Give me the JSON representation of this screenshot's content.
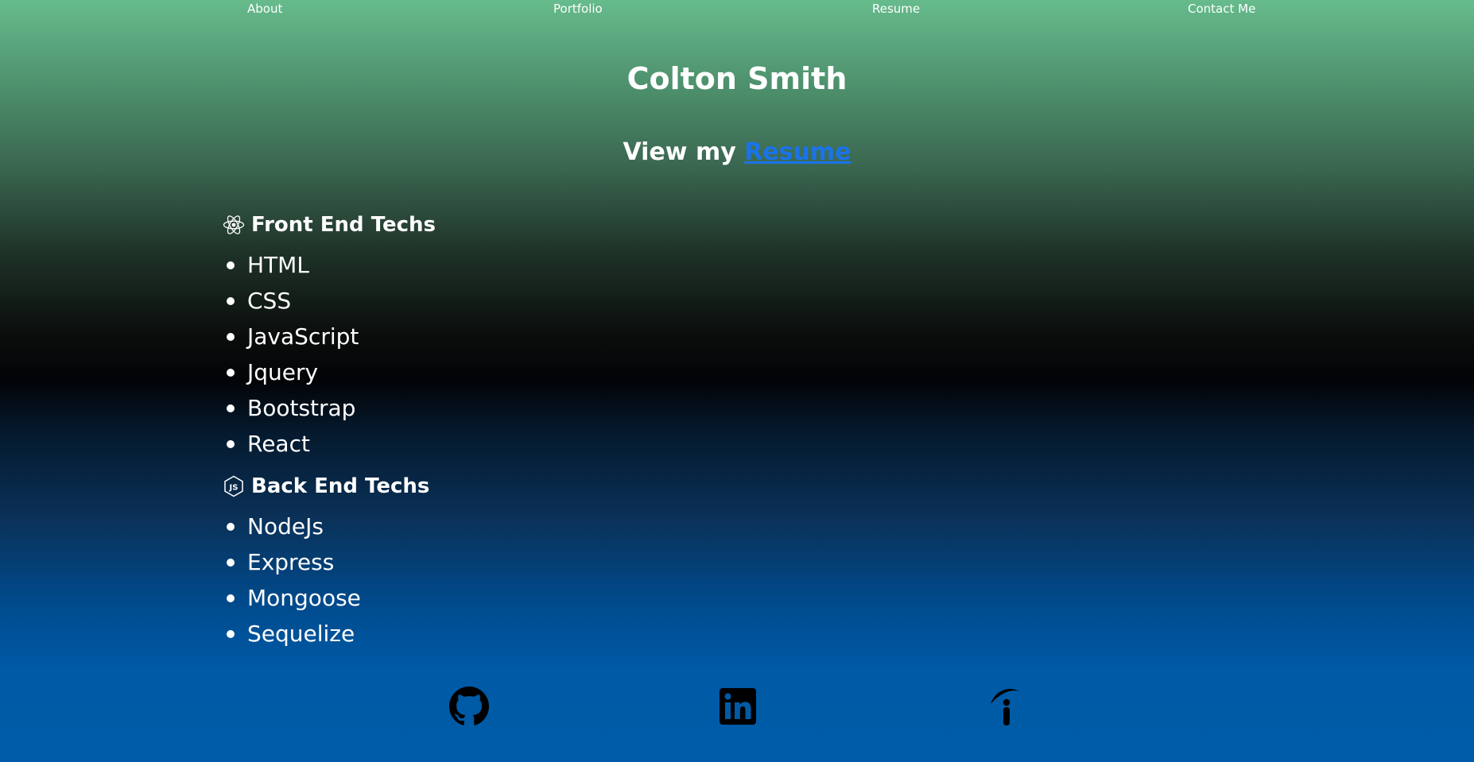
{
  "nav": {
    "items": [
      {
        "label": "About"
      },
      {
        "label": "Portfolio"
      },
      {
        "label": "Resume"
      },
      {
        "label": "Contact Me"
      }
    ]
  },
  "header": {
    "name": "Colton Smith",
    "resume_prefix": "View my",
    "resume_link": "Resume"
  },
  "front_end": {
    "title": "Front End Techs",
    "icon": "react-icon",
    "items": [
      "HTML",
      "CSS",
      "JavaScript",
      "Jquery",
      "Bootstrap",
      "React"
    ]
  },
  "back_end": {
    "title": "Back End Techs",
    "icon": "nodejs-icon",
    "items": [
      "NodeJs",
      "Express",
      "Mongoose",
      "Sequelize"
    ]
  },
  "social": [
    {
      "icon": "github-icon"
    },
    {
      "icon": "linkedin-icon"
    },
    {
      "icon": "indeed-icon"
    }
  ],
  "colors": {
    "link": "#1a73e8",
    "text": "#ffffff",
    "gradient_top": "#66bb8c",
    "gradient_mid": "#030407",
    "gradient_bottom": "#005ca8"
  }
}
